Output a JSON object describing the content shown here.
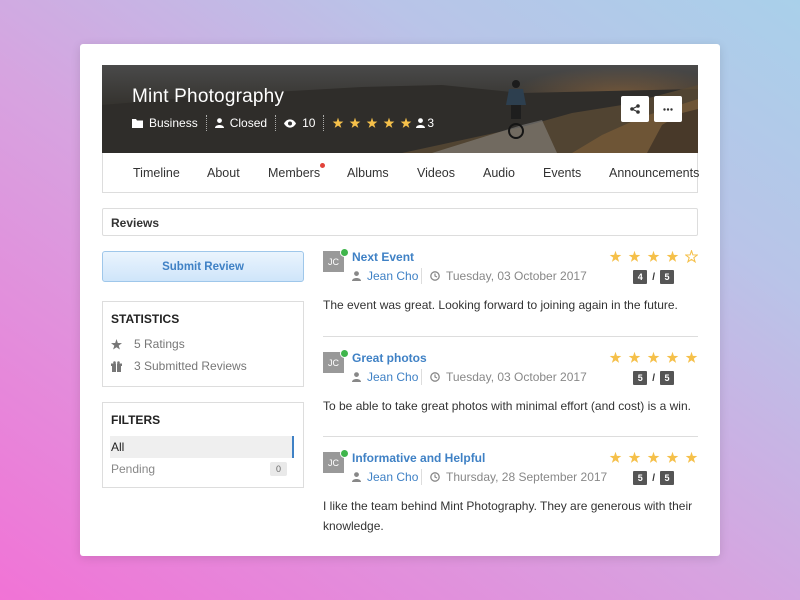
{
  "group": {
    "title": "Mint Photography",
    "category": "Business",
    "privacy": "Closed",
    "views": "10",
    "rating_stars": 5,
    "rating_count": "3"
  },
  "tabs": [
    "Timeline",
    "About",
    "Members",
    "Albums",
    "Videos",
    "Audio",
    "Events",
    "Announcements"
  ],
  "reviews_header": "Reviews",
  "submit_review_label": "Submit Review",
  "statistics": {
    "title": "STATISTICS",
    "ratings": "5 Ratings",
    "submitted": "3 Submitted Reviews"
  },
  "filters": {
    "title": "FILTERS",
    "all": "All",
    "pending": "Pending",
    "pending_count": "0"
  },
  "reviews": [
    {
      "initials": "JC",
      "title": "Next Event",
      "author": "Jean Cho",
      "date": "Tuesday, 03 October 2017",
      "stars": 4,
      "score": "4",
      "max": "5",
      "body": "The event was great. Looking forward to joining again in the future."
    },
    {
      "initials": "JC",
      "title": "Great photos",
      "author": "Jean Cho",
      "date": "Tuesday, 03 October 2017",
      "stars": 5,
      "score": "5",
      "max": "5",
      "body": "To be able to take great photos with minimal effort (and cost) is a win."
    },
    {
      "initials": "JC",
      "title": "Informative and Helpful",
      "author": "Jean Cho",
      "date": "Thursday, 28 September 2017",
      "stars": 5,
      "score": "5",
      "max": "5",
      "body": "I like the team behind Mint Photography. They are generous with their knowledge."
    }
  ],
  "colors": {
    "accent": "#3f81c5",
    "star": "#f5c04a",
    "online": "#3fb54b",
    "notification": "#e2433a"
  }
}
